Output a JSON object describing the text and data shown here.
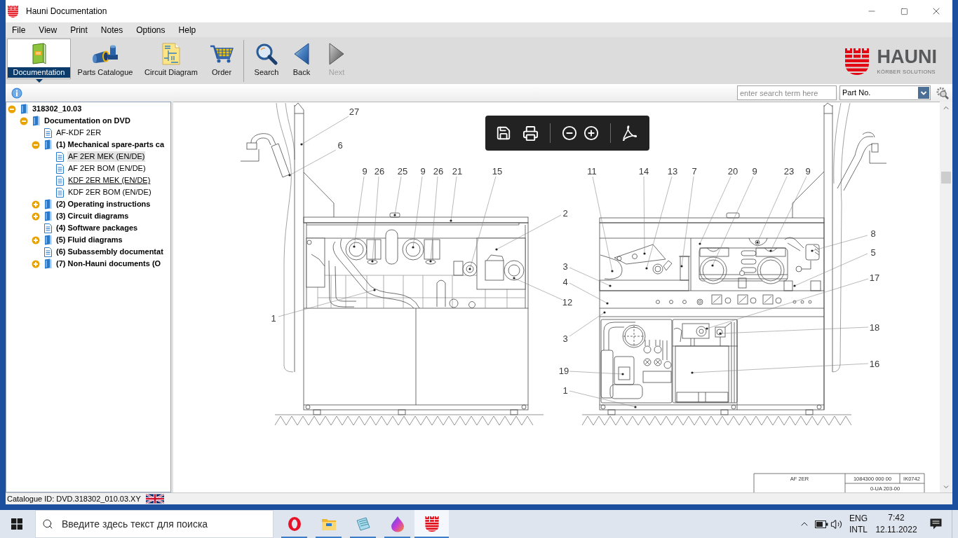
{
  "window": {
    "title": "Hauni Documentation"
  },
  "menu": [
    "File",
    "View",
    "Print",
    "Notes",
    "Options",
    "Help"
  ],
  "toolbar": {
    "modules": [
      {
        "label": "Documentation",
        "kind": "documentation",
        "selected": true
      },
      {
        "label": "Parts Catalogue",
        "kind": "parts",
        "selected": false
      },
      {
        "label": "Circuit Diagram",
        "kind": "circuit",
        "selected": false
      },
      {
        "label": "Order",
        "kind": "order",
        "selected": false
      }
    ],
    "navigation": [
      {
        "label": "Search",
        "kind": "search",
        "disabled": false
      },
      {
        "label": "Back",
        "kind": "back",
        "disabled": false
      },
      {
        "label": "Next",
        "kind": "next",
        "disabled": true
      }
    ]
  },
  "logo": {
    "name": "HAUNI",
    "tagline": "KÖRBER SOLUTIONS"
  },
  "search": {
    "placeholder": "enter search term here",
    "scope": "Part No."
  },
  "tree": [
    {
      "label": "318302_10.03",
      "kind": "book",
      "bold": true,
      "selected": false,
      "expanded": true,
      "children": [
        {
          "label": "Documentation on DVD",
          "kind": "book",
          "bold": true,
          "selected": false,
          "expanded": true,
          "children": [
            {
              "label": "AF-KDF 2ER",
              "kind": "page",
              "bold": false,
              "selected": false
            },
            {
              "label": "(1) Mechanical spare-parts ca",
              "kind": "book",
              "bold": true,
              "selected": false,
              "expanded": true,
              "children": [
                {
                  "label": "AF 2ER MEK (EN/DE)",
                  "kind": "page",
                  "bold": false,
                  "selected": true,
                  "hovered": false
                },
                {
                  "label": "AF 2ER BOM (EN/DE)",
                  "kind": "page",
                  "bold": false,
                  "selected": false,
                  "hovered": false
                },
                {
                  "label": "KDF 2ER MEK (EN/DE)",
                  "kind": "page",
                  "bold": false,
                  "selected": false,
                  "hovered": true
                },
                {
                  "label": "KDF 2ER BOM (EN/DE)",
                  "kind": "page",
                  "bold": false,
                  "selected": false,
                  "hovered": false
                }
              ]
            },
            {
              "label": "(2) Operating instructions",
              "kind": "book",
              "bold": true,
              "selected": false,
              "expanded": false
            },
            {
              "label": "(3) Circuit diagrams",
              "kind": "book",
              "bold": true,
              "selected": false,
              "expanded": false
            },
            {
              "label": "(4) Software packages",
              "kind": "page",
              "bold": true,
              "selected": false
            },
            {
              "label": "(5) Fluid diagrams",
              "kind": "book",
              "bold": true,
              "selected": false,
              "expanded": false
            },
            {
              "label": "(6) Subassembly documentat",
              "kind": "page",
              "bold": true,
              "selected": false
            },
            {
              "label": "(7) Non-Hauni documents (O",
              "kind": "book",
              "bold": true,
              "selected": false,
              "expanded": false
            }
          ]
        }
      ]
    }
  ],
  "viewer": {
    "left_view": {
      "callouts": [
        {
          "label": "27"
        },
        {
          "label": "6"
        },
        {
          "label": "9"
        },
        {
          "label": "26"
        },
        {
          "label": "25"
        },
        {
          "label": "9"
        },
        {
          "label": "26"
        },
        {
          "label": "21"
        },
        {
          "label": "15"
        },
        {
          "label": "2"
        },
        {
          "label": "1"
        },
        {
          "label": "12"
        }
      ]
    },
    "right_view": {
      "callouts": [
        {
          "label": "11"
        },
        {
          "label": "14"
        },
        {
          "label": "13"
        },
        {
          "label": "7"
        },
        {
          "label": "20"
        },
        {
          "label": "9"
        },
        {
          "label": "23"
        },
        {
          "label": "9"
        },
        {
          "label": "8"
        },
        {
          "label": "5"
        },
        {
          "label": "3"
        },
        {
          "label": "4"
        },
        {
          "label": "17"
        },
        {
          "label": "3"
        },
        {
          "label": "18"
        },
        {
          "label": "19"
        },
        {
          "label": "16"
        },
        {
          "label": "1"
        }
      ]
    },
    "title_block": [
      "AF 2ER",
      "1084300 000 00",
      "IK0742",
      "0-UA 203-00"
    ]
  },
  "status_bar": {
    "catalogue_id": "Catalogue ID: DVD.318302_010.03.XY"
  },
  "taskbar": {
    "search_placeholder": "Введите здесь текст для поиска",
    "apps": [
      {
        "kind": "browser",
        "running": true,
        "selected": false
      },
      {
        "kind": "folder",
        "running": true,
        "selected": false
      },
      {
        "kind": "notebook",
        "running": true,
        "selected": false
      },
      {
        "kind": "drop",
        "running": true,
        "selected": false
      },
      {
        "kind": "castle",
        "running": true,
        "selected": true
      }
    ],
    "language": [
      "ENG",
      "INTL"
    ],
    "time": "7:42",
    "date": "12.11.2022"
  }
}
